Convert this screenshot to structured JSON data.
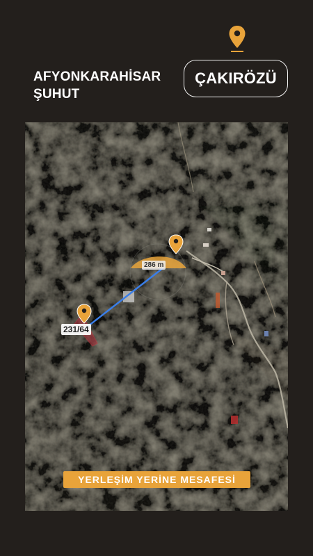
{
  "header": {
    "province": "AFYONKARAHİSAR",
    "district": "ŞUHUT",
    "village": "ÇAKIRÖZÜ",
    "pin_icon": "map-pin-icon"
  },
  "map": {
    "parcel_number": "231/64",
    "distance_label": "286 m",
    "caption": "YERLEŞİM YERİNE MESAFESİ",
    "accent_color": "#e8a33a",
    "line_color": "#3a7ee8",
    "parcel_color": "#b02030"
  }
}
